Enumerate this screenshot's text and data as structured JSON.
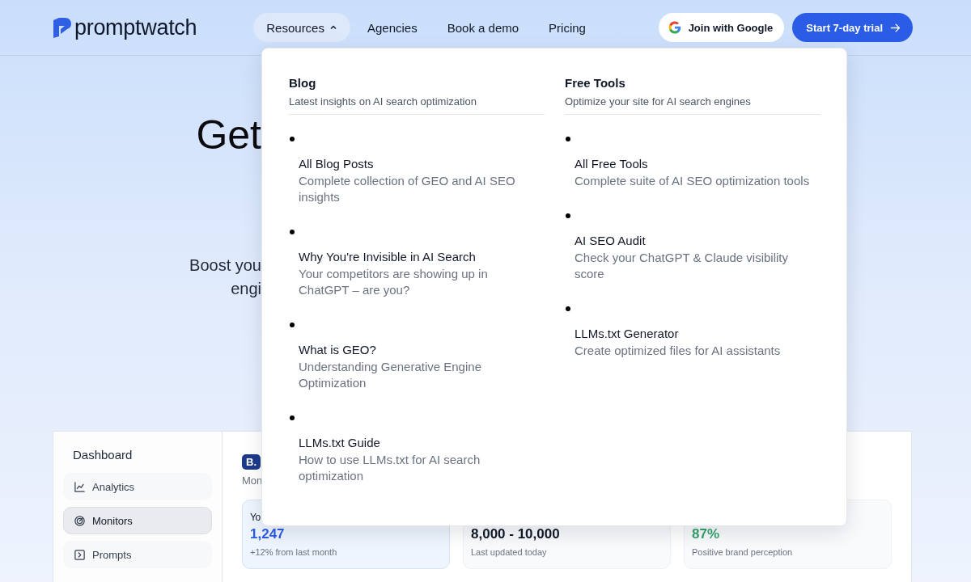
{
  "brand": {
    "name": "promptwatch"
  },
  "nav": [
    {
      "label": "Resources",
      "kind": "menu",
      "expanded": true
    },
    {
      "label": "Agencies",
      "kind": "link"
    },
    {
      "label": "Book a demo",
      "kind": "link"
    },
    {
      "label": "Pricing",
      "kind": "link"
    }
  ],
  "actions": [
    {
      "label": "Join with Google",
      "kind": "google"
    },
    {
      "label": "Start 7-day trial",
      "kind": "primary"
    }
  ],
  "hero": {
    "headline": "Get",
    "subtitle_lines": [
      "Boost you",
      "engi"
    ]
  },
  "dashboard": {
    "sidebar": {
      "title": "Dashboard",
      "items": [
        {
          "label": "Analytics",
          "selected": false
        },
        {
          "label": "Monitors",
          "selected": true
        },
        {
          "label": "Prompts",
          "selected": false
        }
      ]
    },
    "badge": "B.",
    "caption": "Mon",
    "cards": [
      {
        "title": "Yo",
        "value": "1,247",
        "note": "+12% from last month",
        "color": "#2b5ce6",
        "highlighted": true
      },
      {
        "value": "8,000 - 10,000",
        "note": "Last updated today",
        "color": "#111827",
        "highlighted": false
      },
      {
        "value": "87%",
        "note": "Positive brand perception",
        "color": "#34a36b",
        "highlighted": false
      }
    ]
  },
  "dropdown": {
    "columns": [
      {
        "title": "Blog",
        "subtitle": "Latest insights on AI search optimization",
        "items": [
          {
            "title": "All Blog Posts",
            "description": "Complete collection of GEO and AI SEO insights"
          },
          {
            "title": "Why You're Invisible in AI Search",
            "description": "Your competitors are showing up in ChatGPT – are you?"
          },
          {
            "title": "What is GEO?",
            "description": "Understanding Generative Engine Optimization"
          },
          {
            "title": "LLMs.txt Guide",
            "description": "How to use LLMs.txt for AI search optimization"
          }
        ]
      },
      {
        "title": "Free Tools",
        "subtitle": "Optimize your site for AI search engines",
        "items": [
          {
            "title": "All Free Tools",
            "description": "Complete suite of AI SEO optimization tools"
          },
          {
            "title": "AI SEO Audit",
            "description": "Check your ChatGPT & Claude visibility score"
          },
          {
            "title": "LLMs.txt Generator",
            "description": "Create optimized files for AI assistants"
          }
        ]
      }
    ]
  }
}
